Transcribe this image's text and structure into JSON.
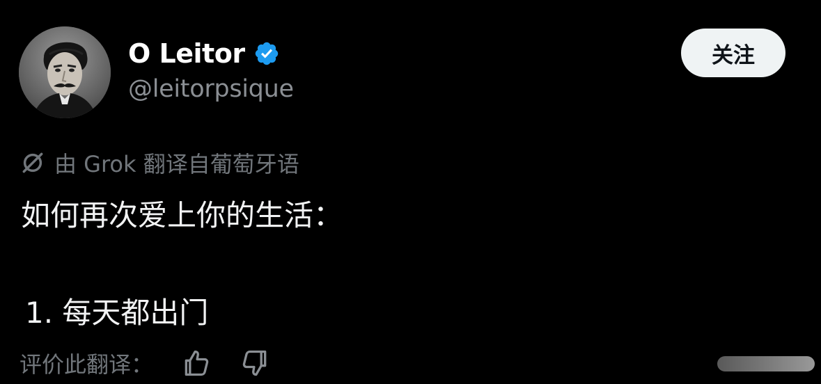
{
  "author": {
    "display_name": "O Leitor",
    "handle": "@leitorpsique",
    "verified": true,
    "avatar_icon": "portrait-photo"
  },
  "follow_button": {
    "label": "关注"
  },
  "translation": {
    "icon": "grok-icon",
    "label": "由 Grok 翻译自葡萄牙语"
  },
  "tweet": {
    "line1": "如何再次爱上你的生活：",
    "line2": "1. 每天都出门"
  },
  "rate": {
    "label": "评价此翻译：",
    "thumb_up_icon": "thumbs-up-icon",
    "thumb_down_icon": "thumbs-down-icon"
  },
  "colors": {
    "background": "#000000",
    "verified_blue": "#1d9bf0",
    "muted_text": "#71767b",
    "follow_bg": "#eff3f4"
  }
}
